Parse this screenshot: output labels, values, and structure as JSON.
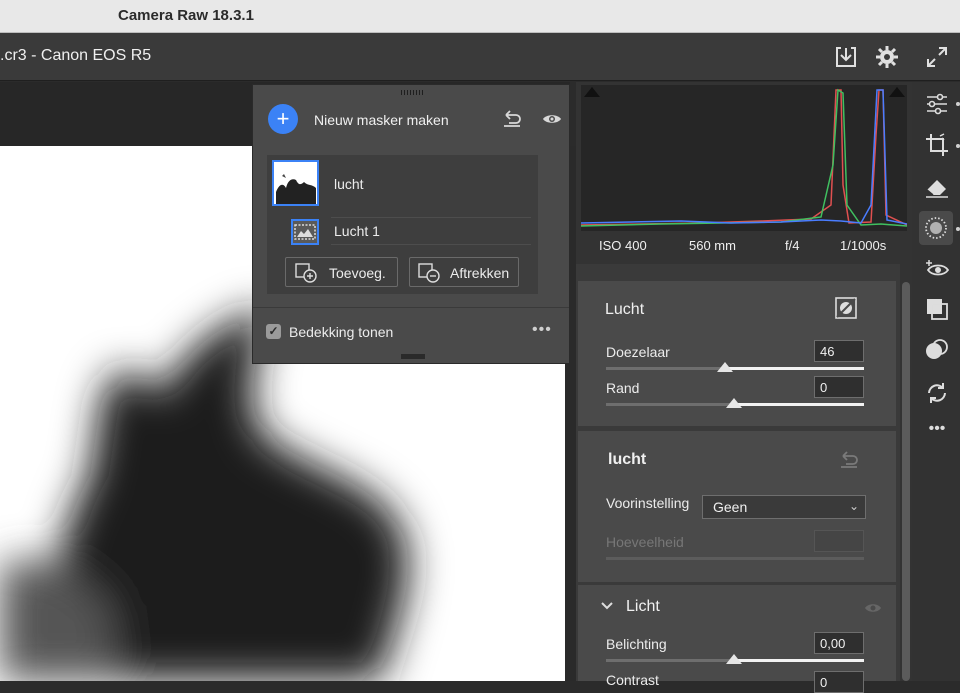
{
  "window": {
    "title": "Camera Raw 18.3.1"
  },
  "header": {
    "filename": ".cr3  -  Canon EOS R5",
    "icons": [
      "save-icon",
      "gear-icon",
      "fullscreen-icon"
    ]
  },
  "mask_panel": {
    "create_label": "Nieuw masker maken",
    "mask_name": "lucht",
    "submask_name": "Lucht 1",
    "add_label": "Toevoeg.",
    "subtract_label": "Aftrekken",
    "overlay_label": "Bedekking tonen",
    "overlay_checked": true,
    "more": "•••"
  },
  "histogram": {
    "iso": "ISO 400",
    "focal": "560 mm",
    "aperture": "f/4",
    "shutter": "1/1000s"
  },
  "mask_props": {
    "title": "Lucht",
    "feather_label": "Doezelaar",
    "feather_value": "46",
    "feather_level": 0.46,
    "edge_label": "Rand",
    "edge_value": "0",
    "edge_level": 0.5
  },
  "adjust": {
    "title": "lucht",
    "preset_label": "Voorinstelling",
    "preset_value": "Geen",
    "amount_label": "Hoeveelheid"
  },
  "light": {
    "title": "Licht",
    "exposure_label": "Belichting",
    "exposure_value": "0,00",
    "exposure_level": 0.5,
    "contrast_label": "Contrast",
    "contrast_value": "0"
  },
  "tools": [
    "edit-icon",
    "crop-icon",
    "eraser-icon",
    "masking-icon",
    "red-eye-icon",
    "presets-icon",
    "snapshots-icon",
    "sync-icon",
    "more-icon"
  ],
  "colors": {
    "accent": "#3b82f6",
    "panel": "#4a4a4a",
    "background": "#2b2b2b"
  }
}
